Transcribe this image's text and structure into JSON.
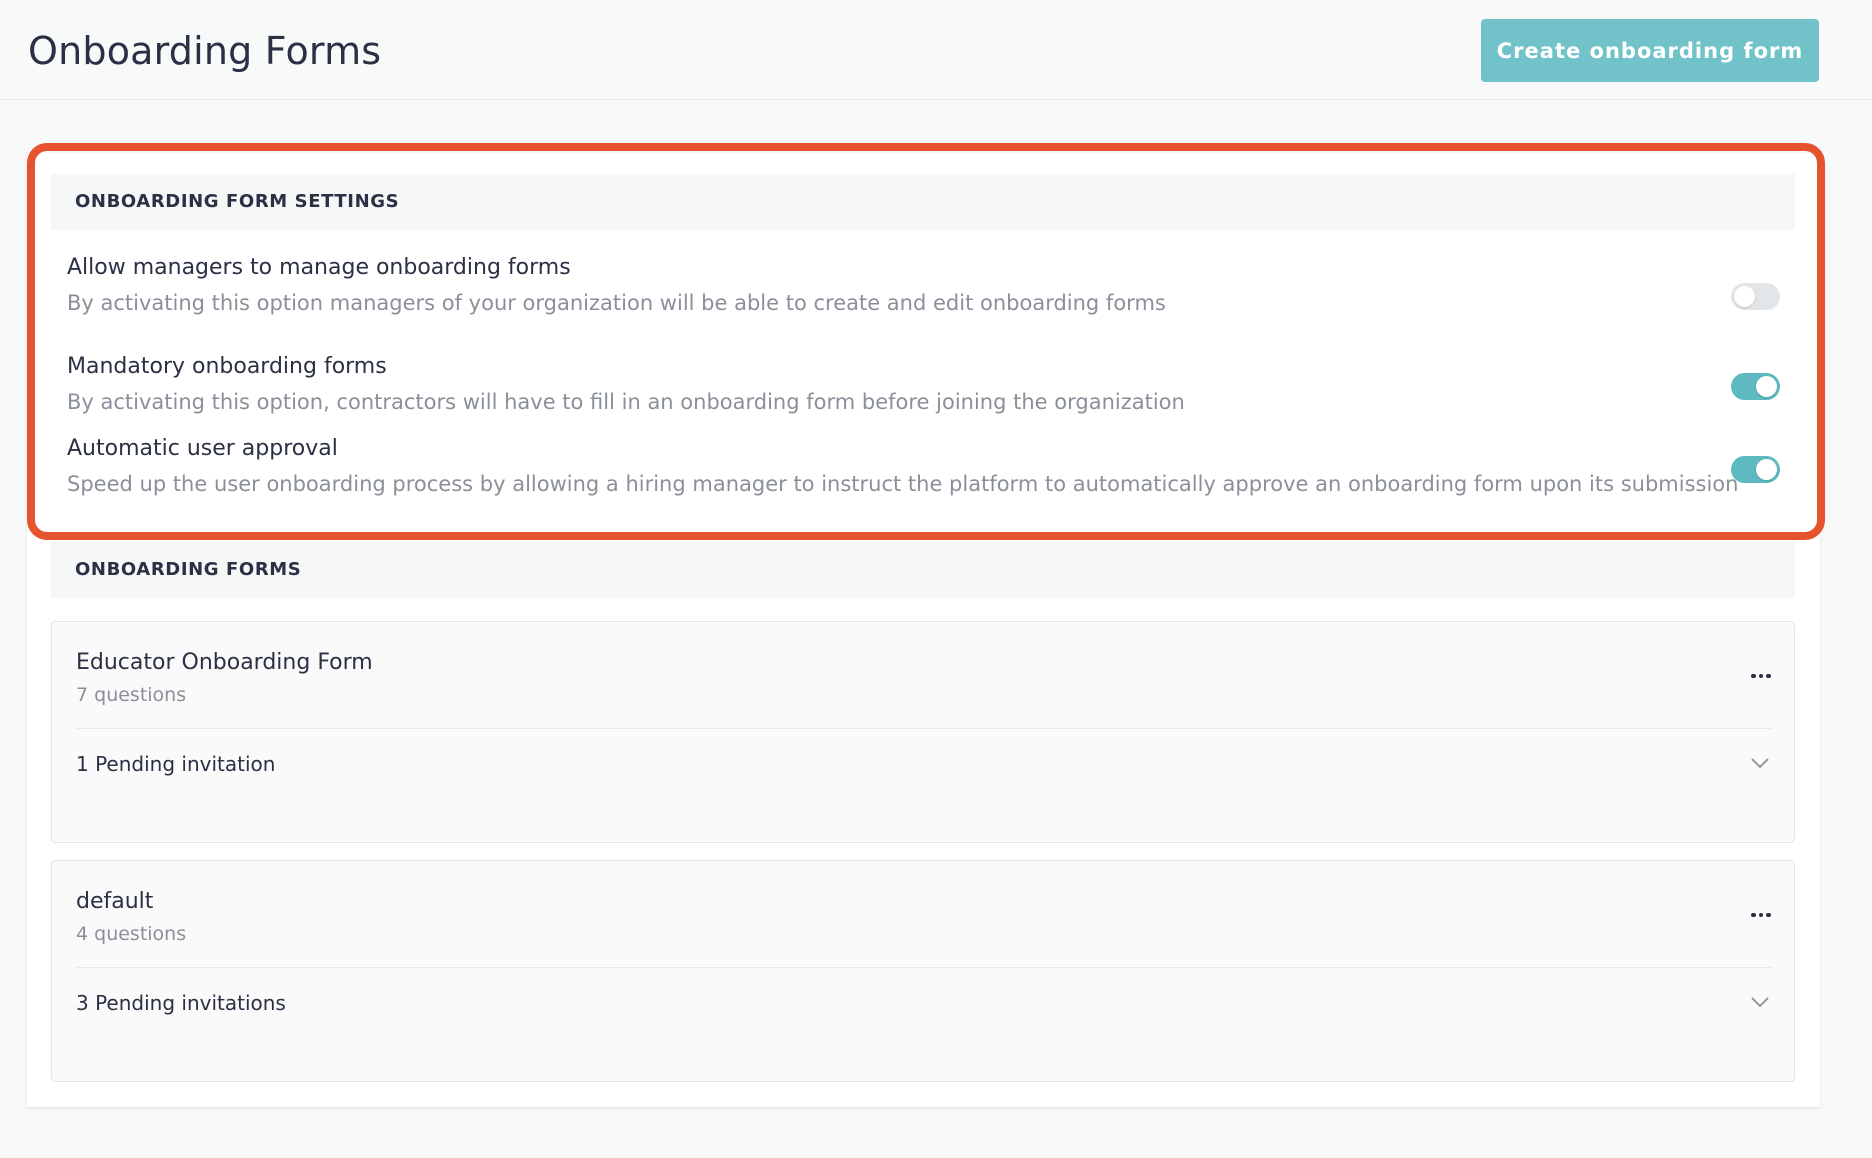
{
  "header": {
    "title": "Onboarding Forms",
    "create_button_label": "Create onboarding form"
  },
  "colors": {
    "accent": "#72c3c9",
    "toggle_on": "#5fb9c1",
    "highlight": "#e5532f"
  },
  "settings": {
    "heading": "ONBOARDING FORM SETTINGS",
    "items": [
      {
        "title": "Allow managers to manage onboarding forms",
        "description": "By activating this option managers of your organization will be able to create and edit onboarding forms",
        "enabled": false
      },
      {
        "title": "Mandatory onboarding forms",
        "description": "By activating this option, contractors will have to fill in an onboarding form before joining the organization",
        "enabled": true
      },
      {
        "title": "Automatic user approval",
        "description": "Speed up the user onboarding process by allowing a hiring manager to instruct the platform to automatically approve an onboarding form upon its submission",
        "enabled": true
      }
    ]
  },
  "forms": {
    "heading": "ONBOARDING FORMS",
    "items": [
      {
        "name": "Educator Onboarding Form",
        "questions": "7 questions",
        "pending": "1 Pending invitation"
      },
      {
        "name": "default",
        "questions": "4 questions",
        "pending": "3 Pending invitations"
      }
    ]
  },
  "icons": {
    "more": "more-horizontal-icon",
    "expand": "chevron-down-icon"
  }
}
